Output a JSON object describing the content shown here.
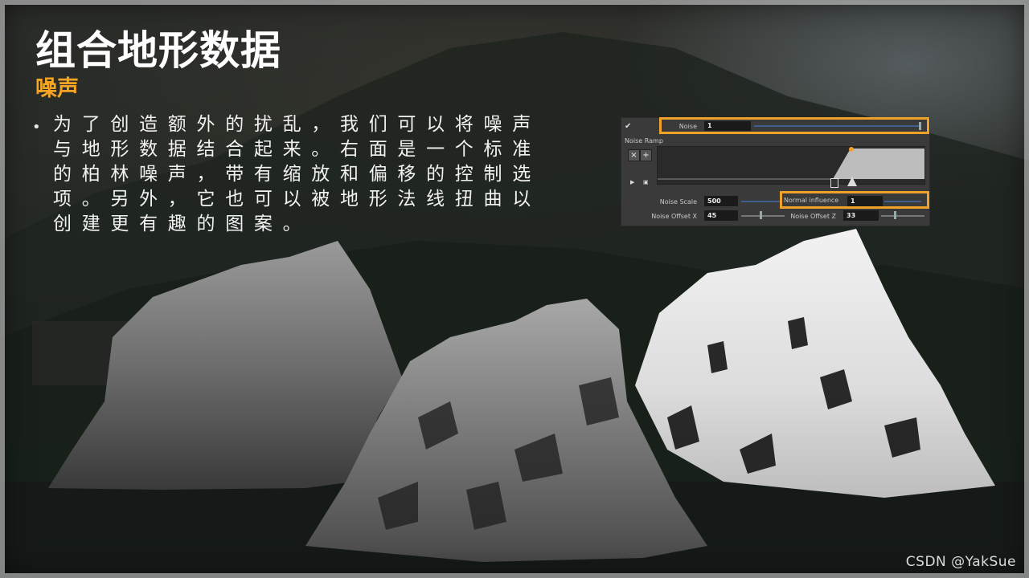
{
  "slide": {
    "title": "组合地形数据",
    "subtitle": "噪声",
    "bullet": "为了创造额外的扰乱，我们可以将噪声与地形数据结合起来。右面是一个标准的柏林噪声，带有缩放和偏移的控制选项。另外，它也可以被地形法线扭曲以创建更有趣的图案。",
    "watermark": "CSDN @YakSue"
  },
  "panel": {
    "noise_label": "Noise",
    "noise_value": "1",
    "ramp_label": "Noise Ramp",
    "noise_scale_label": "Noise Scale",
    "noise_scale_value": "500",
    "normal_influence_label": "Normal influence",
    "normal_influence_value": "1",
    "offset_x_label": "Noise Offset X",
    "offset_x_value": "45",
    "offset_z_label": "Noise Offset Z",
    "offset_z_value": "33",
    "add_label": "+",
    "remove_label": "×"
  },
  "colors": {
    "accent": "#f5a524",
    "highlight": "#f0a12a",
    "panel_bg": "#3a3a3a"
  }
}
